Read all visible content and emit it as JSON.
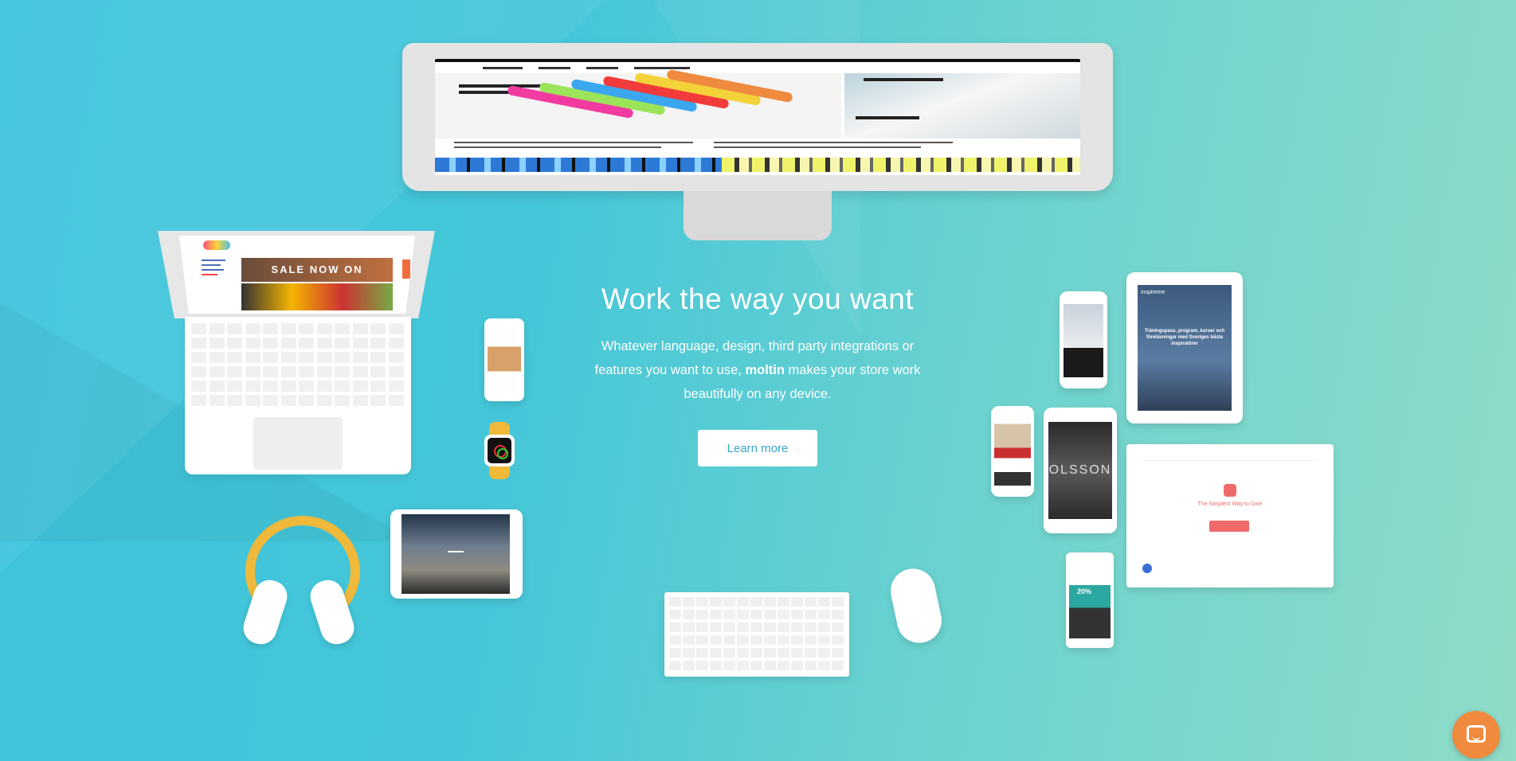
{
  "hero": {
    "headline": "Work the way you want",
    "body_prefix": "Whatever language, design, third party integrations or features you want to use, ",
    "brand": "moltin",
    "body_suffix": " makes your store work beautifully on any device.",
    "cta_label": "Learn more"
  },
  "devices": {
    "laptop_banner": "SALE NOW ON",
    "tablet_brand": "inspireme",
    "tablet_text": "Träningspass, program, kurser och föreläsningar med Sveriges bästa inspiratörer",
    "phone_brand": "OLSSON",
    "web_tagline": "The Simplest Way to Give",
    "phone_promo": "20%"
  },
  "colors": {
    "accent": "#3aa8c8",
    "chat": "#f08a3e",
    "headphones": "#f0b93a"
  },
  "icons": {
    "chat": "chat-icon"
  }
}
